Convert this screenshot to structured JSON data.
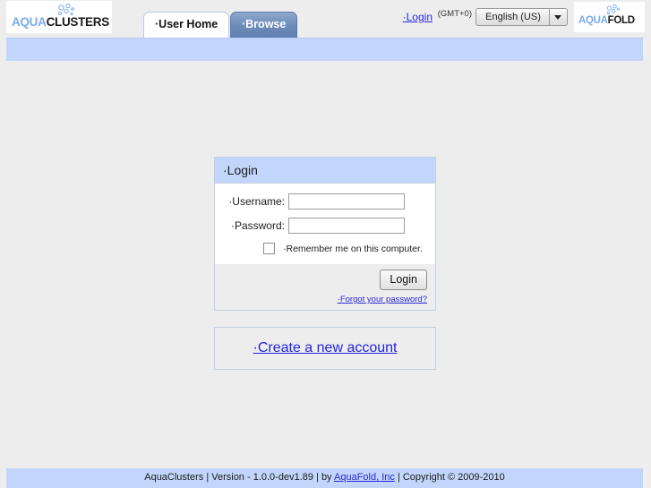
{
  "header": {
    "brand_logo": {
      "icon": "bubbles-icon",
      "part1": "AQUA",
      "part2": "CLUSTERS"
    },
    "tabs": [
      {
        "label": "·User Home",
        "active": true
      },
      {
        "label": "·Browse",
        "active": false
      }
    ],
    "login_link": "·Login",
    "timezone": "(GMT+0)",
    "language": {
      "selected": "English (US)",
      "options": [
        "English (US)"
      ],
      "arrow_icon": "chevron-down-icon"
    },
    "vendor_logo": {
      "icon": "bubbles-icon",
      "part1": "AQUA",
      "part2": "FOLD"
    }
  },
  "login_panel": {
    "title": "·Login",
    "username": {
      "label": "·Username:",
      "value": "",
      "placeholder": ""
    },
    "password": {
      "label": "·Password:",
      "value": "",
      "placeholder": ""
    },
    "remember": {
      "label": "·Remember me on this computer.",
      "checked": false
    },
    "submit_label": "Login",
    "forgot_label": "·Forgot your password?"
  },
  "create_account": {
    "link_label": "·Create a new account"
  },
  "footer": {
    "prefix": "AquaClusters | Version - 1.0.0-dev1.89 | by ",
    "link": "AquaFold, Inc",
    "suffix": " | Copyright © 2009-2010"
  },
  "colors": {
    "page_background": "#ededed",
    "bar_blue": "#c2d6fb",
    "link_blue": "#2828d8",
    "logo_blue": "#7aaaee",
    "tab_inactive": "#6f8dba"
  }
}
